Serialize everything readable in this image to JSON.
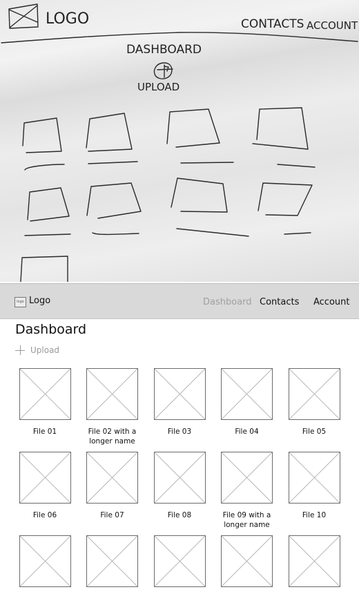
{
  "sketch": {
    "logo_text": "LOGO",
    "nav": [
      "CONTACTS",
      "ACCOUNT"
    ],
    "title": "DASHBOARD",
    "upload_label": "UPLOAD",
    "tile_count": 9
  },
  "wireframe": {
    "logo_badge": "logo",
    "logo_text": "Logo",
    "nav": [
      {
        "label": "Dashboard",
        "active": true
      },
      {
        "label": "Contacts",
        "active": false
      },
      {
        "label": "Account",
        "active": false
      }
    ],
    "page_title": "Dashboard",
    "upload_label": "Upload",
    "files": [
      "File 01",
      "File 02 with a longer name",
      "File 03",
      "File 04",
      "File 05",
      "File 06",
      "File 07",
      "File 08",
      "File 09 with a longer name",
      "File 10",
      "",
      "",
      "",
      "",
      ""
    ]
  }
}
